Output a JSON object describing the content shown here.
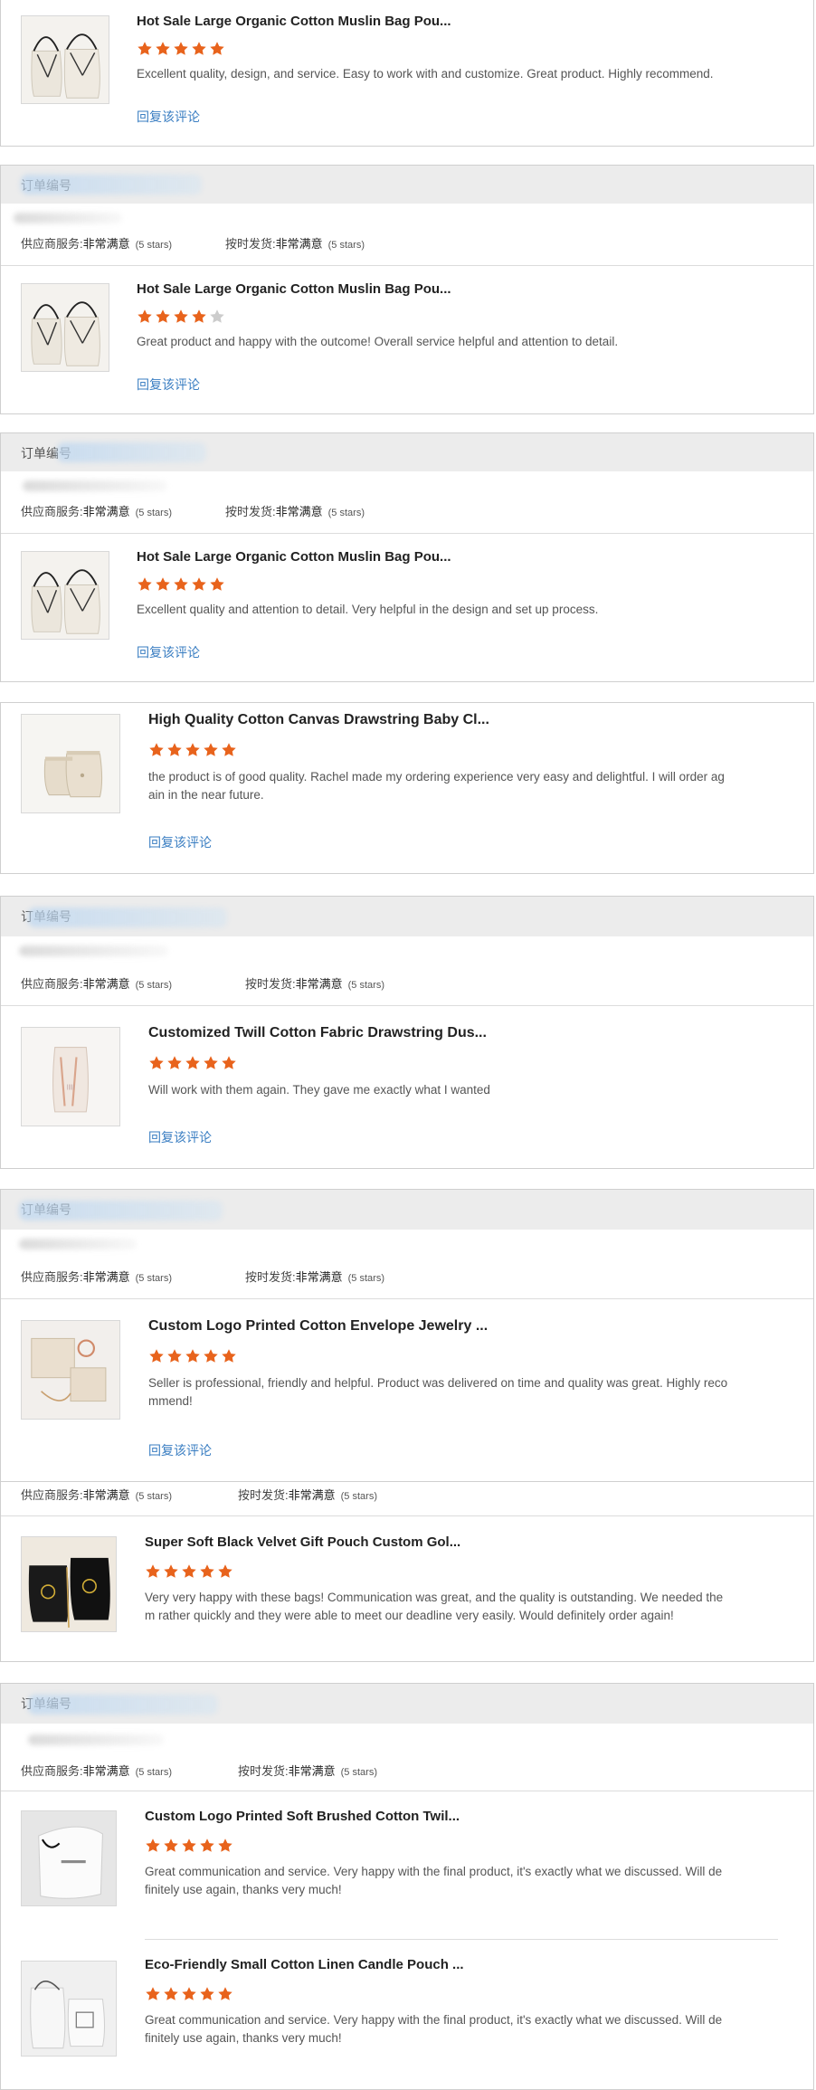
{
  "reply_label": "回复该评论",
  "order_label": "订单编号",
  "rating_labels": {
    "supplier_service": "供应商服务:",
    "on_time": "按时发货:"
  },
  "rating_value": "非常满意",
  "rating_stars_text": "(5 stars)",
  "colors": {
    "star": "#e8631c",
    "star_empty": "#cccccc",
    "link": "#3a7ec2",
    "header_bg": "#ececec"
  },
  "reviews": [
    {
      "title": "Hot Sale Large Organic Cotton Muslin Bag Pou...",
      "stars": 5,
      "text": "Excellent quality, design, and service. Easy to work with and customize. Great product. Highly recommend.",
      "thumb_icon": "muslin-bags-image"
    },
    {
      "title": "Hot Sale Large Organic Cotton Muslin Bag Pou...",
      "stars": 4,
      "text": "Great product and happy with the outcome! Overall service helpful and attention to detail.",
      "thumb_icon": "muslin-bags-image"
    },
    {
      "title": "Hot Sale Large Organic Cotton Muslin Bag Pou...",
      "stars": 5,
      "text": "Excellent quality and attention to detail.  Very helpful in the design and set up process.",
      "thumb_icon": "muslin-bags-image"
    },
    {
      "title": "High Quality Cotton Canvas Drawstring Baby Cl...",
      "stars": 5,
      "text": "the product is of good quality. Rachel made my ordering experience very easy and delightful. I will order ag\nain in the near future.",
      "thumb_icon": "canvas-pouch-image"
    },
    {
      "title": "Customized Twill Cotton Fabric Drawstring Dus...",
      "stars": 5,
      "text": "Will work with them again. They gave me exactly what I wanted",
      "thumb_icon": "twill-bag-image"
    },
    {
      "title": "Custom Logo Printed Cotton Envelope Jewelry ...",
      "stars": 5,
      "text": "Seller is professional, friendly and helpful. Product was delivered on time and quality was great. Highly reco\nmmend!",
      "thumb_icon": "envelope-pouch-image"
    },
    {
      "title": "Super Soft Black Velvet Gift Pouch Custom Gol...",
      "stars": 5,
      "text": "Very very happy with these bags! Communication was great, and the quality is outstanding. We needed the\nm rather quickly and they were able to meet our deadline very easily. Would definitely order again!",
      "thumb_icon": "velvet-pouch-image"
    },
    {
      "title": "Custom Logo Printed Soft Brushed Cotton Twil...",
      "stars": 5,
      "text": "Great communication and service. Very happy with the final product, it's exactly what we discussed. Will de\nfinitely use again, thanks very much!",
      "thumb_icon": "white-drawstring-image"
    },
    {
      "title": "Eco-Friendly Small Cotton Linen Candle Pouch ...",
      "stars": 5,
      "text": "Great communication and service. Very happy with the final product, it's exactly what we discussed. Will de\nfinitely use again, thanks very much!",
      "thumb_icon": "linen-pouch-image"
    }
  ]
}
